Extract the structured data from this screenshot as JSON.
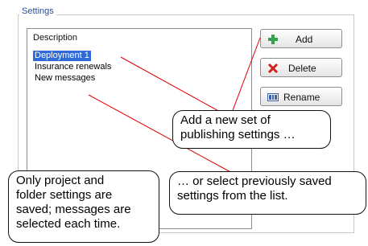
{
  "settings": {
    "group_title": "Settings",
    "list_header": "Description",
    "items": [
      {
        "label": "Deployment 1",
        "selected": true
      },
      {
        "label": "Insurance renewals",
        "selected": false
      },
      {
        "label": "New messages",
        "selected": false
      }
    ],
    "buttons": {
      "add": {
        "label": "Add",
        "icon": "plus-icon"
      },
      "delete": {
        "label": "Delete",
        "icon": "delete-x-icon"
      },
      "rename": {
        "label": "Rename",
        "icon": "rename-icon"
      }
    }
  },
  "callouts": {
    "add": "Add a new set of\npublishing settings …",
    "select": "… or select previously saved\nsettings from the list.",
    "saved": "Only project and\nfolder settings are\nsaved; messages are\nselected each time."
  },
  "colors": {
    "group_title": "#2a4f9c",
    "selection": "#2f6bd6",
    "pointer_line": "#e00000",
    "plus_icon": "#34a24a",
    "delete_icon": "#d21f1f"
  }
}
